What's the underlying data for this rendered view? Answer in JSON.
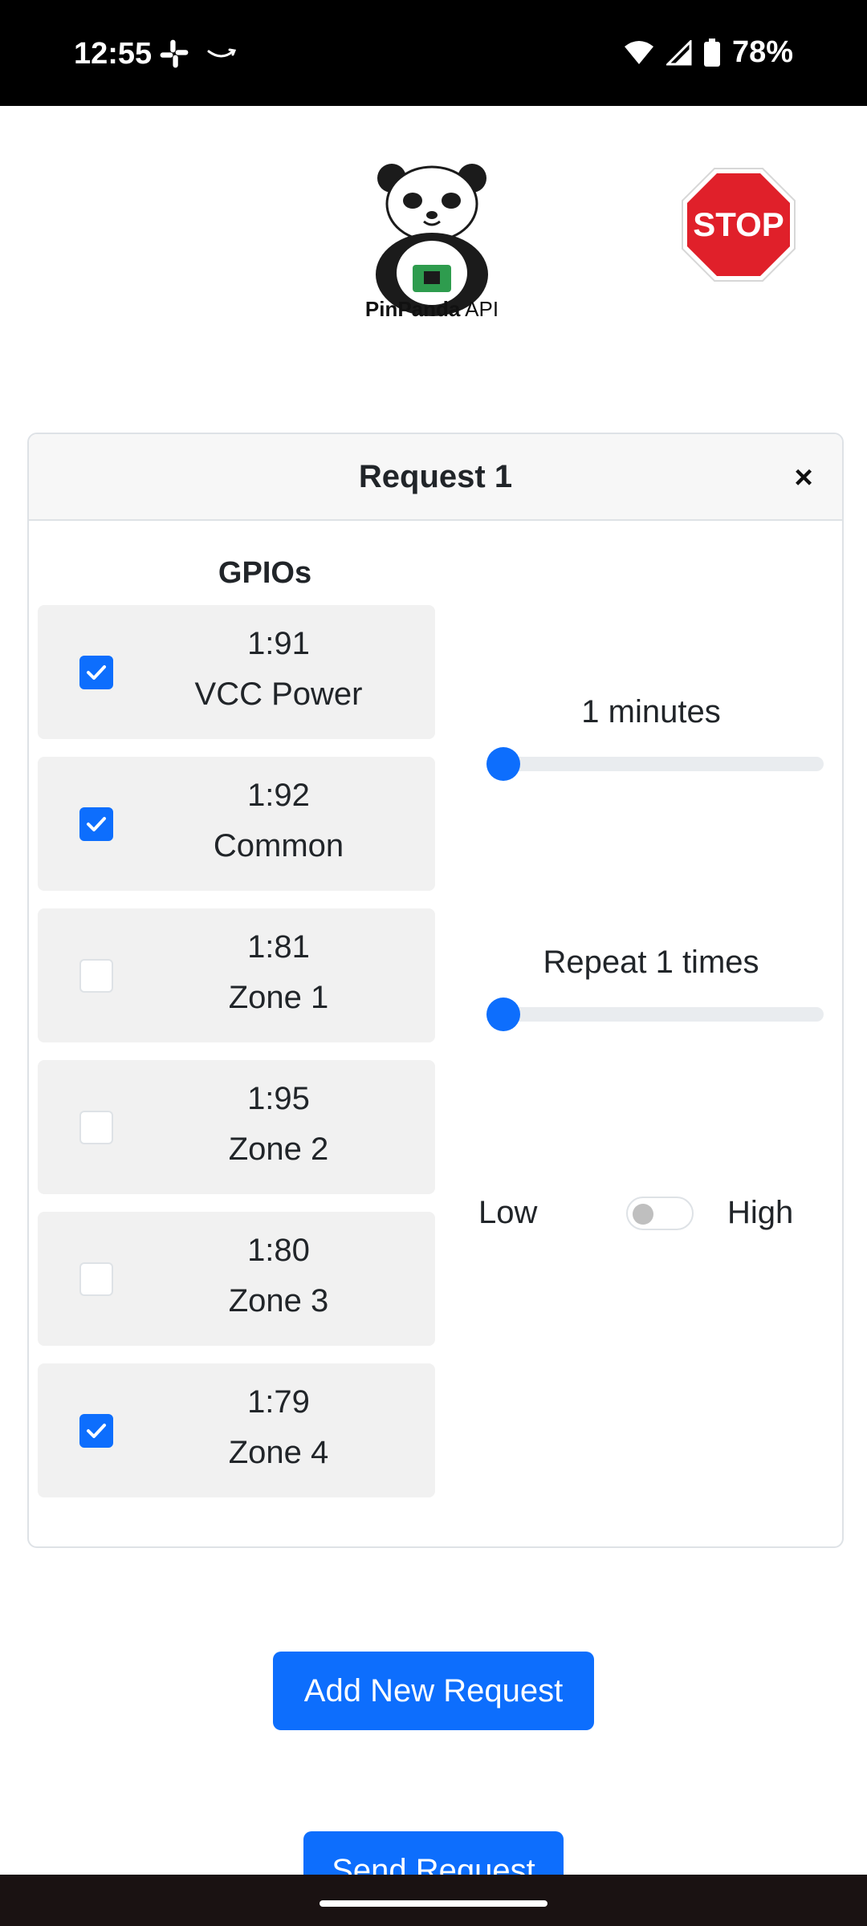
{
  "status_bar": {
    "time": "12:55",
    "battery": "78%",
    "icons": [
      "slack-icon",
      "amazon-icon",
      "wifi-icon",
      "signal-icon",
      "battery-icon"
    ]
  },
  "header": {
    "logo_brand": "PinPanda",
    "logo_suffix": "API",
    "stop_label": "STOP"
  },
  "request_card": {
    "title": "Request 1",
    "close_label": "×",
    "gpio_heading": "GPIOs",
    "gpios": [
      {
        "pin": "1:91",
        "name": "VCC Power",
        "checked": true
      },
      {
        "pin": "1:92",
        "name": "Common",
        "checked": true
      },
      {
        "pin": "1:81",
        "name": "Zone 1",
        "checked": false
      },
      {
        "pin": "1:95",
        "name": "Zone 2",
        "checked": false
      },
      {
        "pin": "1:80",
        "name": "Zone 3",
        "checked": false
      },
      {
        "pin": "1:79",
        "name": "Zone 4",
        "checked": true
      }
    ],
    "duration_label": "1 minutes",
    "duration_value": 1,
    "repeat_label": "Repeat 1 times",
    "repeat_value": 1,
    "switch_low": "Low",
    "switch_high": "High",
    "switch_on": false
  },
  "buttons": {
    "add_request": "Add New Request",
    "send_request": "Send Request"
  },
  "colors": {
    "primary": "#0d6efd",
    "stop_red": "#e0202a",
    "card_border": "#dee2e6",
    "item_bg": "#f1f1f1"
  }
}
